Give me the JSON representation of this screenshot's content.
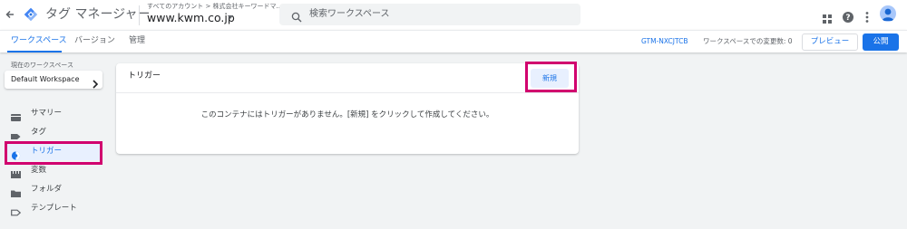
{
  "header": {
    "app_title": "タグ マネージャー",
    "breadcrumb": "すべてのアカウント > 株式会社キーワードマ...",
    "container_name": "www.kwm.co.jp",
    "search_placeholder": "検索ワークスペース"
  },
  "subnav": {
    "tabs": [
      {
        "label": "ワークスペース",
        "active": true
      },
      {
        "label": "バージョン",
        "active": false
      },
      {
        "label": "管理",
        "active": false
      }
    ],
    "container_id": "GTM-NXCJTCB",
    "changes_text": "ワークスペースでの変更数: 0",
    "preview_label": "プレビュー",
    "publish_label": "公開"
  },
  "sidebar": {
    "workspace_label": "現在のワークスペース",
    "workspace_name": "Default Workspace",
    "items": [
      {
        "label": "サマリー",
        "icon": "summary-icon",
        "active": false
      },
      {
        "label": "タグ",
        "icon": "tag-icon",
        "active": false
      },
      {
        "label": "トリガー",
        "icon": "trigger-icon",
        "active": true
      },
      {
        "label": "変数",
        "icon": "variable-icon",
        "active": false
      },
      {
        "label": "フォルダ",
        "icon": "folder-icon",
        "active": false
      },
      {
        "label": "テンプレート",
        "icon": "template-icon",
        "active": false
      }
    ]
  },
  "main": {
    "card_title": "トリガー",
    "new_button_label": "新規",
    "empty_message": "このコンテナにはトリガーがありません。[新規] をクリックして作成してください。"
  },
  "colors": {
    "accent": "#1a73e8",
    "highlight": "#d1006e",
    "active_bg": "#e8f0fe"
  }
}
